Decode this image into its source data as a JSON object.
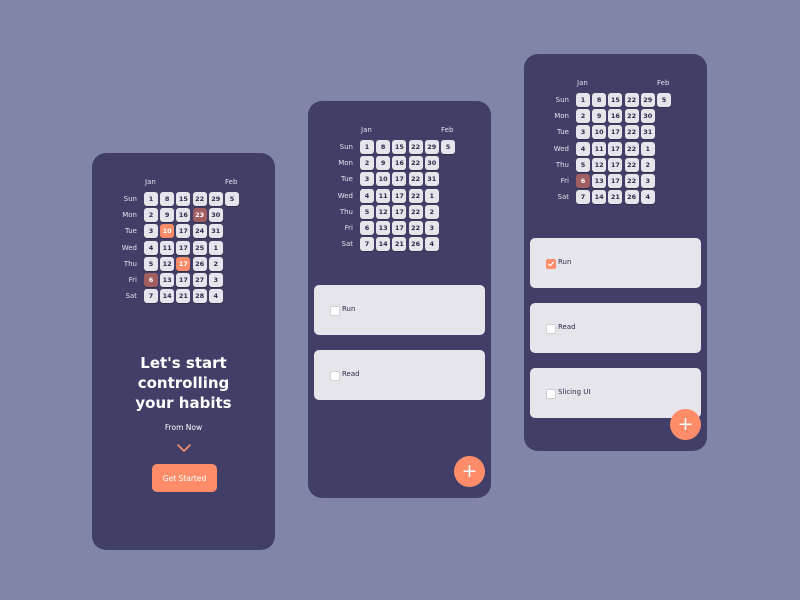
{
  "colors": {
    "background": "#8185a7",
    "phone": "#413f68",
    "cell": "#e6e5ec",
    "accent": "#fe8c68",
    "missed": "#a05e61"
  },
  "calendar": {
    "months": [
      "Jan",
      "Feb"
    ],
    "days": [
      "Sun",
      "Mon",
      "Tue",
      "Wed",
      "Thu",
      "Fri",
      "Sat"
    ],
    "grid": [
      [
        "1",
        "8",
        "15",
        "22",
        "29",
        "5"
      ],
      [
        "2",
        "9",
        "16",
        "23",
        "30",
        ""
      ],
      [
        "3",
        "10",
        "17",
        "24",
        "31",
        ""
      ],
      [
        "4",
        "11",
        "17",
        "25",
        "1",
        ""
      ],
      [
        "5",
        "12",
        "17",
        "26",
        "2",
        ""
      ],
      [
        "6",
        "13",
        "17",
        "27",
        "3",
        ""
      ],
      [
        "7",
        "14",
        "21",
        "28",
        "4",
        ""
      ]
    ]
  },
  "screens": [
    {
      "calendar_grid": [
        [
          "1",
          "8",
          "15",
          "22",
          "29",
          "5"
        ],
        [
          "2",
          "9",
          "16",
          "23",
          "30",
          ""
        ],
        [
          "3",
          "10",
          "17",
          "24",
          "31",
          ""
        ],
        [
          "4",
          "11",
          "17",
          "25",
          "1",
          ""
        ],
        [
          "5",
          "12",
          "17",
          "26",
          "2",
          ""
        ],
        [
          "6",
          "13",
          "17",
          "27",
          "3",
          ""
        ],
        [
          "7",
          "14",
          "21",
          "28",
          "4",
          ""
        ]
      ],
      "highlighted": [
        {
          "day": "Mon",
          "value": "23",
          "style": "missed"
        },
        {
          "day": "Tue",
          "value": "10",
          "style": "accent"
        },
        {
          "day": "Thu",
          "value": "17",
          "style": "accent"
        },
        {
          "day": "Fri",
          "value": "6",
          "style": "missed"
        }
      ],
      "headline_line1": "Let's start controlling",
      "headline_line2": "your habits",
      "from_now": "From Now",
      "cta_label": "Get Started"
    },
    {
      "calendar_grid": [
        [
          "1",
          "8",
          "15",
          "22",
          "29",
          "5"
        ],
        [
          "2",
          "9",
          "16",
          "22",
          "30",
          ""
        ],
        [
          "3",
          "10",
          "17",
          "22",
          "31",
          ""
        ],
        [
          "4",
          "11",
          "17",
          "22",
          "1",
          ""
        ],
        [
          "5",
          "12",
          "17",
          "22",
          "2",
          ""
        ],
        [
          "6",
          "13",
          "17",
          "22",
          "3",
          ""
        ],
        [
          "7",
          "14",
          "21",
          "26",
          "4",
          ""
        ]
      ],
      "highlighted": [],
      "habits": [
        {
          "label": "Run",
          "checked": false
        },
        {
          "label": "Read",
          "checked": false
        }
      ],
      "fab_label": "+"
    },
    {
      "calendar_grid": [
        [
          "1",
          "8",
          "15",
          "22",
          "29",
          "5"
        ],
        [
          "2",
          "9",
          "16",
          "22",
          "30",
          ""
        ],
        [
          "3",
          "10",
          "17",
          "22",
          "31",
          ""
        ],
        [
          "4",
          "11",
          "17",
          "22",
          "1",
          ""
        ],
        [
          "5",
          "12",
          "17",
          "22",
          "2",
          ""
        ],
        [
          "6",
          "13",
          "17",
          "22",
          "3",
          ""
        ],
        [
          "7",
          "14",
          "21",
          "26",
          "4",
          ""
        ]
      ],
      "highlighted": [
        {
          "day": "Fri",
          "value": "6",
          "style": "missed"
        }
      ],
      "habits": [
        {
          "label": "Run",
          "checked": true
        },
        {
          "label": "Read",
          "checked": false
        },
        {
          "label": "Slicing UI",
          "checked": false
        }
      ],
      "fab_label": "+"
    }
  ]
}
